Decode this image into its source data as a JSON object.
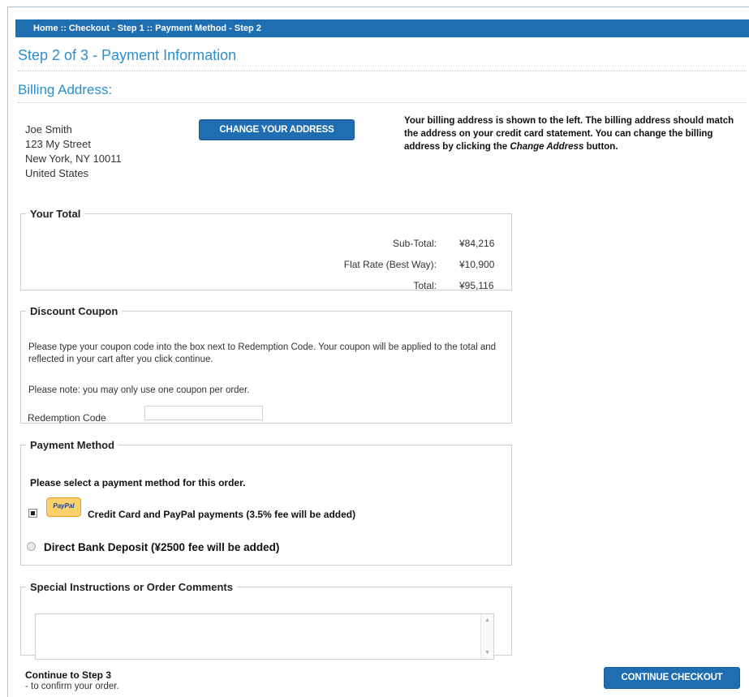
{
  "breadcrumb": {
    "home": "Home",
    "step1": "Checkout - Step 1",
    "step2": "Payment Method - Step 2",
    "separator": "::"
  },
  "page_title": "Step 2 of 3 - Payment Information",
  "billing": {
    "title": "Billing Address:",
    "name": "Joe Smith",
    "street": "123 My Street",
    "city_line": "New York, NY 10011",
    "country": "United States",
    "change_button": "CHANGE YOUR ADDRESS",
    "note_part1": "Your billing address is shown to the left. The billing address should match the address on your credit card statement. You can change the billing address by clicking the",
    "note_emph": "Change Address",
    "note_part2": "button."
  },
  "total": {
    "legend": "Your Total",
    "rows": [
      {
        "label": "Sub-Total:",
        "value": "¥84,216"
      },
      {
        "label": "Flat Rate (Best Way):",
        "value": "¥10,900"
      },
      {
        "label": "Total:",
        "value": "¥95,116"
      }
    ]
  },
  "coupon": {
    "legend": "Discount Coupon",
    "instructions": "Please type your coupon code into the box next to Redemption Code. Your coupon will be applied to the total and reflected in your cart after you click continue.",
    "note": "Please note: you may only use one coupon per order.",
    "field_label": "Redemption Code",
    "field_value": ""
  },
  "payment": {
    "legend": "Payment Method",
    "prompt": "Please select a payment method for this order.",
    "options": [
      {
        "label": "Credit Card and PayPal payments (3.5% fee will be added)",
        "selected": true,
        "logo_text": "PayPal"
      },
      {
        "label": "Direct Bank Deposit (¥2500 fee will be added)",
        "selected": false
      }
    ]
  },
  "comments": {
    "legend": "Special Instructions or Order Comments",
    "value": ""
  },
  "footer": {
    "continue_title": "Continue to Step 3",
    "continue_sub": "- to confirm your order.",
    "continue_button": "CONTINUE CHECKOUT"
  },
  "colors": {
    "accent_blue": "#1f6eb2",
    "title_blue": "#2b8fcf",
    "paypal_yellow": "#fbd06d"
  }
}
